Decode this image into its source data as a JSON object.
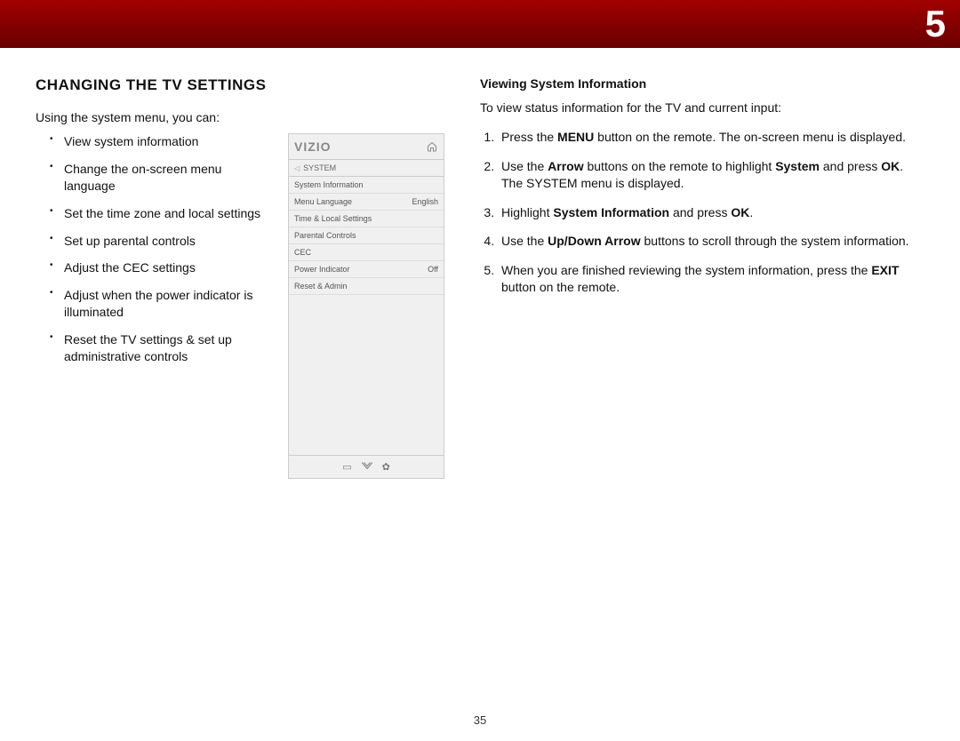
{
  "banner": {
    "chapter_number": "5"
  },
  "page_number": "35",
  "left": {
    "heading": "CHANGING THE TV SETTINGS",
    "intro": "Using the system menu, you can:",
    "bullets": [
      "View system information",
      "Change the on-screen menu language",
      "Set the time zone and local settings",
      "Set up parental controls",
      "Adjust the CEC settings",
      "Adjust when the power indicator is illuminated",
      "Reset the TV settings & set up administrative controls"
    ]
  },
  "tv_menu": {
    "logo": "VIZIO",
    "breadcrumb": "SYSTEM",
    "rows": [
      {
        "label": "System Information",
        "value": ""
      },
      {
        "label": "Menu Language",
        "value": "English"
      },
      {
        "label": "Time & Local Settings",
        "value": ""
      },
      {
        "label": "Parental Controls",
        "value": ""
      },
      {
        "label": "CEC",
        "value": ""
      },
      {
        "label": "Power Indicator",
        "value": "Off"
      },
      {
        "label": "Reset & Admin",
        "value": ""
      }
    ]
  },
  "right": {
    "subhead": "Viewing System Information",
    "intro": "To view status information for the TV and current input:",
    "steps": [
      {
        "pre": "Press the ",
        "b1": "MENU",
        "post1": " button on the remote. The on-screen menu is displayed."
      },
      {
        "pre": "Use the ",
        "b1": "Arrow",
        "mid1": " buttons on the remote to highlight ",
        "b2": "System",
        "mid2": " and press ",
        "b3": "OK",
        "post": ". The SYSTEM menu is displayed."
      },
      {
        "pre": "Highlight ",
        "b1": "System Information",
        "mid1": " and press ",
        "b2": "OK",
        "post": "."
      },
      {
        "pre": "Use the ",
        "b1": "Up/Down Arrow",
        "post1": " buttons to scroll through the system information."
      },
      {
        "pre": "When you are finished reviewing the system information, press the ",
        "b1": "EXIT",
        "post1": " button on the remote."
      }
    ]
  }
}
